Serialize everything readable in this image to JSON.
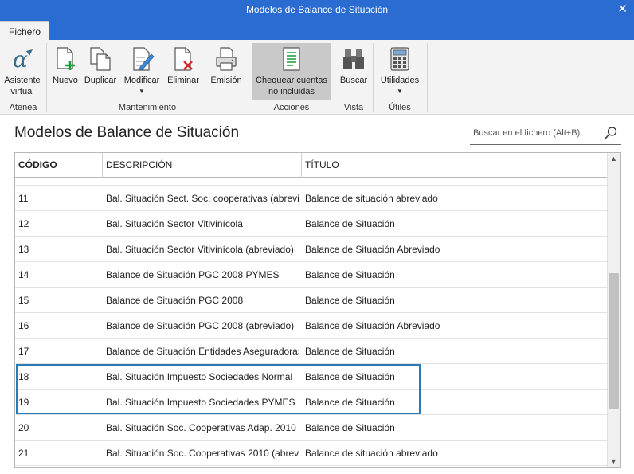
{
  "window": {
    "title": "Modelos de Balance de Situación",
    "close_glyph": "✕"
  },
  "tabs": [
    {
      "label": "Fichero"
    }
  ],
  "ribbon": {
    "groups": [
      {
        "label": "Atenea",
        "buttons": [
          {
            "label": "Asistente virtual",
            "icon": "alpha-icon"
          }
        ]
      },
      {
        "label": "Mantenimiento",
        "buttons": [
          {
            "label": "Nuevo",
            "icon": "new-document-icon"
          },
          {
            "label": "Duplicar",
            "icon": "duplicate-icon"
          },
          {
            "label": "Modificar",
            "icon": "edit-document-icon",
            "dropdown": true
          },
          {
            "label": "Eliminar",
            "icon": "delete-document-icon"
          },
          {
            "label": "Emisión",
            "icon": "printer-icon"
          }
        ]
      },
      {
        "label": "Acciones",
        "buttons": [
          {
            "label": "Chequear cuentas no incluidas",
            "icon": "check-list-icon",
            "active": true
          }
        ]
      },
      {
        "label": "Vista",
        "buttons": [
          {
            "label": "Buscar",
            "icon": "binoculars-icon"
          }
        ]
      },
      {
        "label": "Útiles",
        "buttons": [
          {
            "label": "Utilidades",
            "icon": "calculator-icon",
            "dropdown": true
          }
        ]
      }
    ]
  },
  "page": {
    "heading": "Modelos de Balance de Situación"
  },
  "search": {
    "placeholder": "Buscar en el fichero (Alt+B)"
  },
  "table": {
    "columns": [
      "CÓDIGO",
      "DESCRIPCIÓN",
      "TÍTULO"
    ],
    "rows": [
      {
        "code": "11",
        "description": "Bal. Situación Sect. Soc. cooperativas (abrevi...",
        "title": "Balance de situación abreviado"
      },
      {
        "code": "12",
        "description": "Bal. Situación Sector Vitivinícola",
        "title": "Balance de Situación"
      },
      {
        "code": "13",
        "description": "Bal. Situación Sector Vitivinícola (abreviado)",
        "title": "Balance de Situación Abreviado"
      },
      {
        "code": "14",
        "description": "Balance de Situación PGC 2008 PYMES",
        "title": "Balance de Situación"
      },
      {
        "code": "15",
        "description": "Balance de Situación PGC 2008",
        "title": "Balance de Situación"
      },
      {
        "code": "16",
        "description": "Balance de Situación PGC 2008 (abreviado)",
        "title": "Balance de Situación Abreviado"
      },
      {
        "code": "17",
        "description": "Balance de Situación Entidades Aseguradoras",
        "title": "Balance de Situación"
      },
      {
        "code": "18",
        "description": "Bal. Situación  Impuesto Sociedades Normal",
        "title": "Balance de Situación"
      },
      {
        "code": "19",
        "description": "Bal. Situación  Impuesto Sociedades PYMES",
        "title": "Balance de Situación"
      },
      {
        "code": "20",
        "description": "Bal. Situación Soc. Cooperativas Adap. 2010",
        "title": "Balance de Situación"
      },
      {
        "code": "21",
        "description": "Bal. Situación Soc. Cooperativas 2010 (abrev...",
        "title": "Balance de situación abreviado"
      }
    ]
  },
  "colors": {
    "titlebar": "#2b6cd2",
    "ribbon": "#f3f3f3",
    "highlight_border": "#2a7ab8",
    "active_button": "#c9c9c9"
  }
}
